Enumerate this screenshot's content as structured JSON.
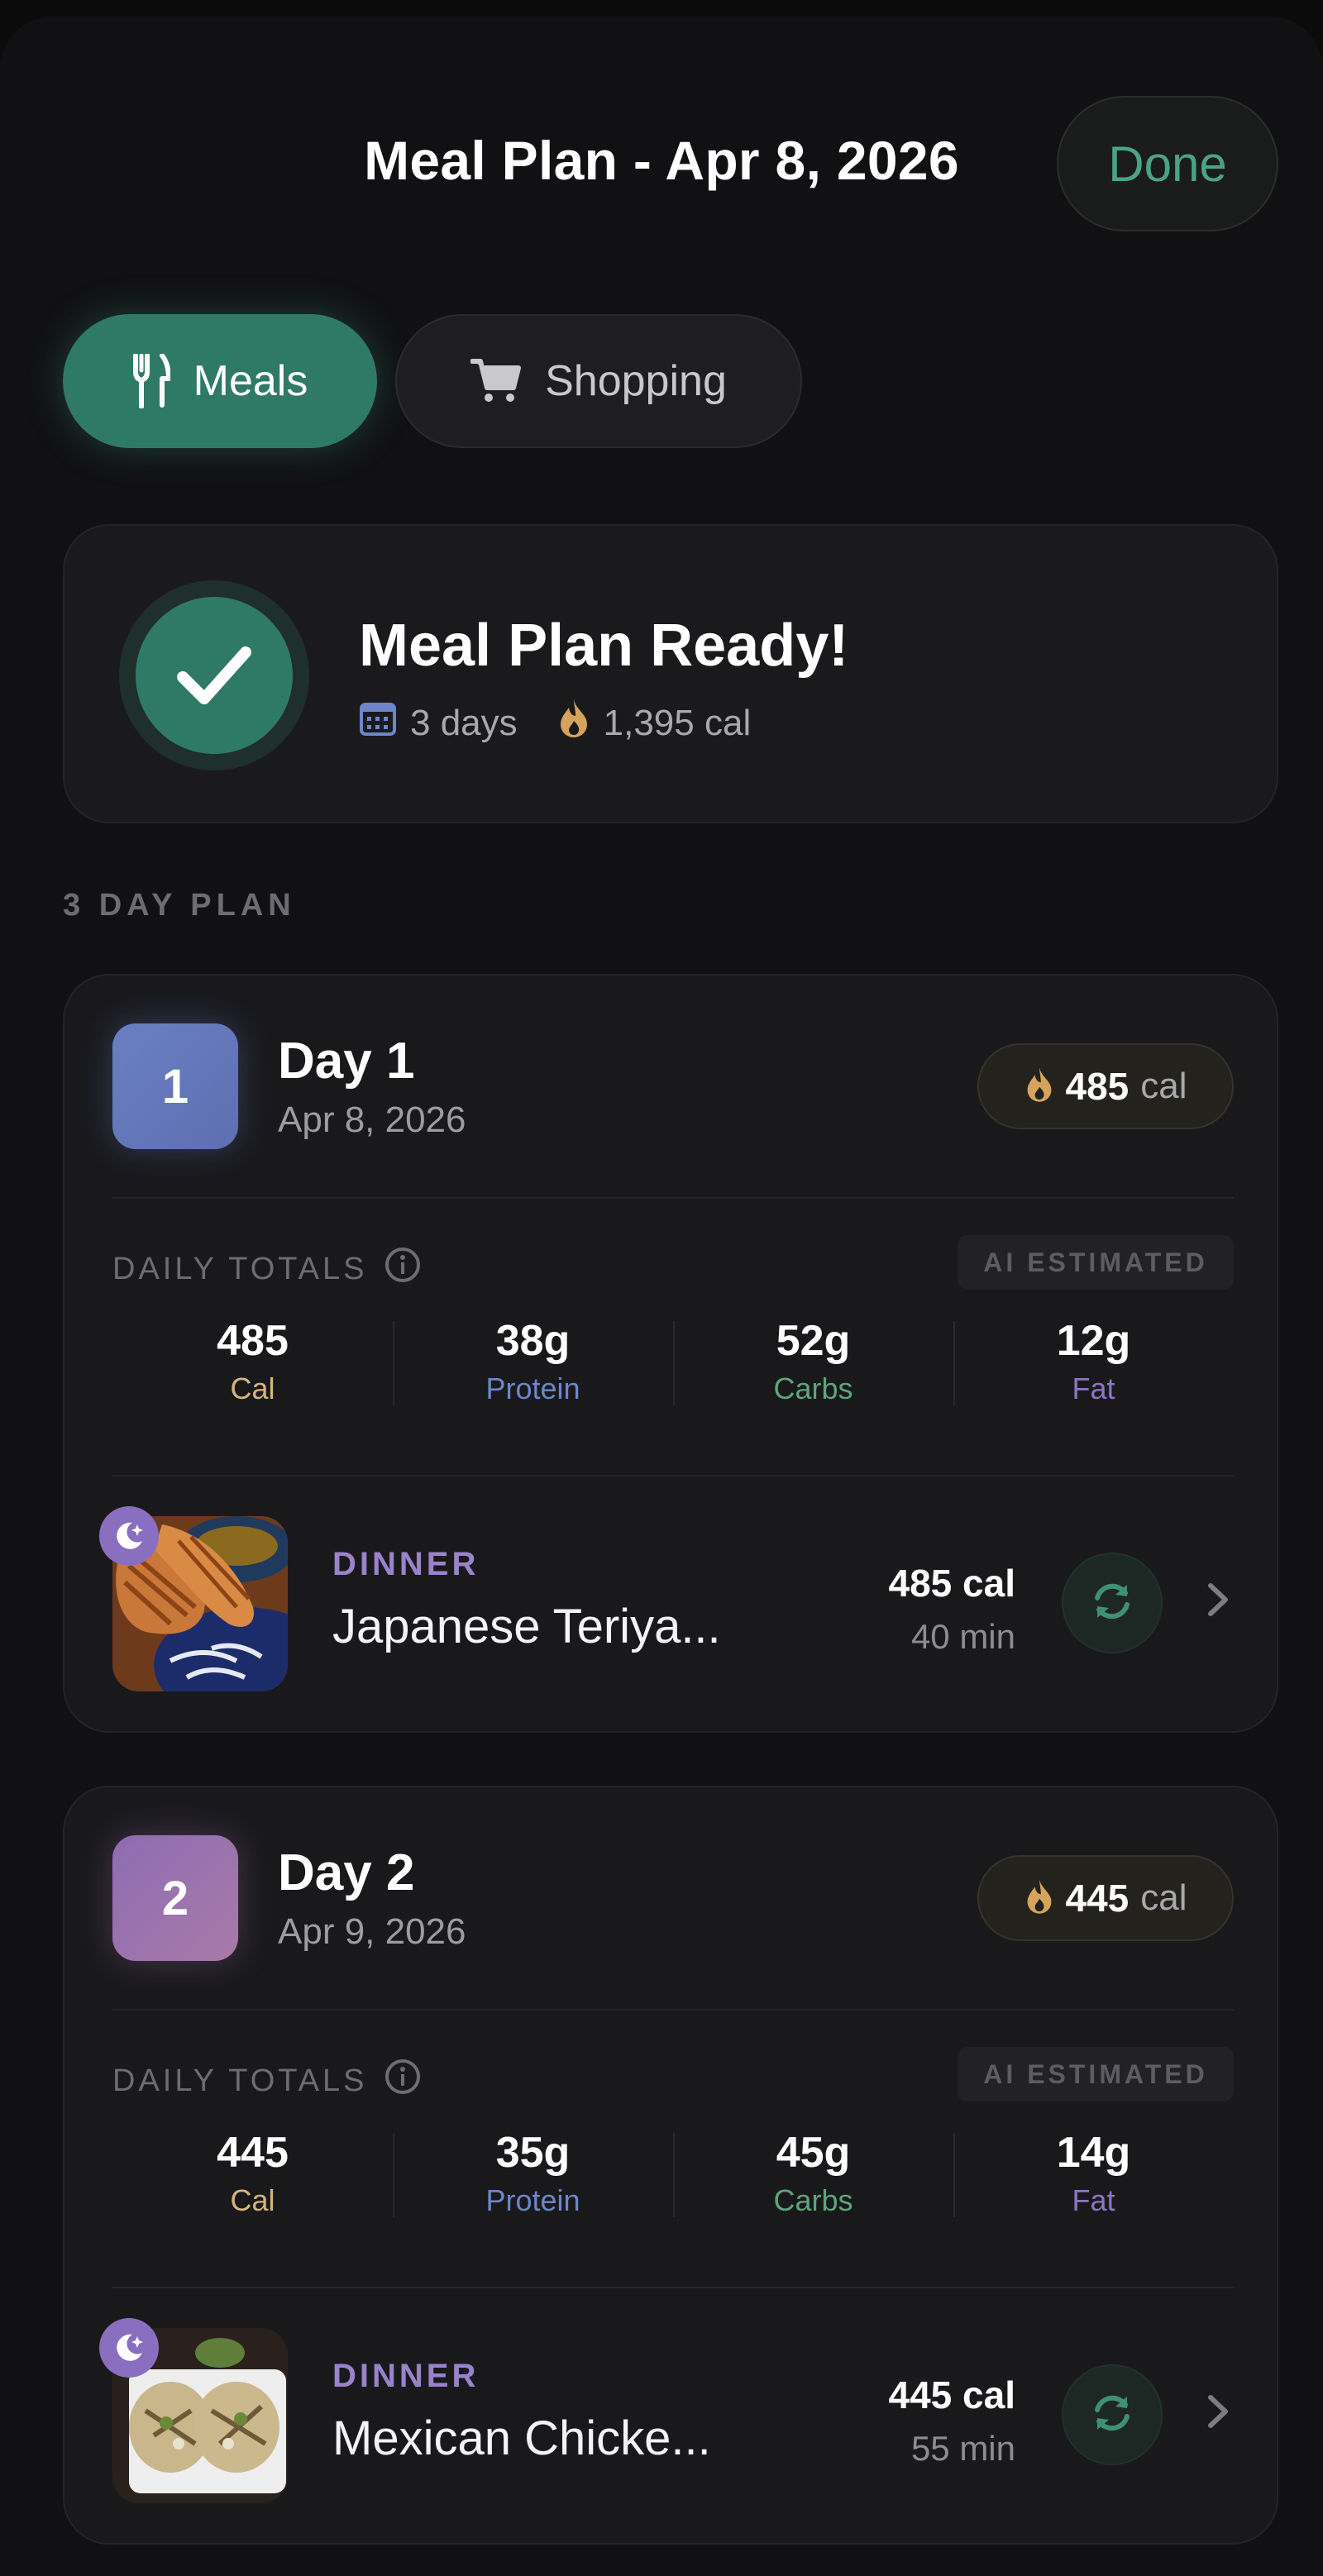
{
  "header": {
    "title": "Meal Plan - Apr 8, 2026",
    "done_label": "Done"
  },
  "tabs": [
    {
      "label": "Meals",
      "icon": "fork-knife-icon",
      "active": true
    },
    {
      "label": "Shopping",
      "icon": "cart-icon",
      "active": false
    }
  ],
  "ready": {
    "title": "Meal Plan Ready!",
    "days": "3 days",
    "calories": "1,395 cal"
  },
  "section_label": "3 DAY PLAN",
  "days": [
    {
      "badge": "1",
      "title": "Day 1",
      "date": "Apr 8, 2026",
      "cal_num": "485",
      "cal_unit": "cal",
      "totals_label": "DAILY TOTALS",
      "ai_label": "AI ESTIMATED",
      "macros": [
        {
          "value": "485",
          "label": "Cal"
        },
        {
          "value": "38g",
          "label": "Protein"
        },
        {
          "value": "52g",
          "label": "Carbs"
        },
        {
          "value": "12g",
          "label": "Fat"
        }
      ],
      "meal": {
        "type": "DINNER",
        "name": "Japanese Teriya...",
        "cal": "485 cal",
        "time": "40 min"
      }
    },
    {
      "badge": "2",
      "title": "Day 2",
      "date": "Apr 9, 2026",
      "cal_num": "445",
      "cal_unit": "cal",
      "totals_label": "DAILY TOTALS",
      "ai_label": "AI ESTIMATED",
      "macros": [
        {
          "value": "445",
          "label": "Cal"
        },
        {
          "value": "35g",
          "label": "Protein"
        },
        {
          "value": "45g",
          "label": "Carbs"
        },
        {
          "value": "14g",
          "label": "Fat"
        }
      ],
      "meal": {
        "type": "DINNER",
        "name": "Mexican Chicke...",
        "cal": "445 cal",
        "time": "55 min"
      }
    }
  ],
  "colors": {
    "accent": "#2f7a66",
    "done_text": "#4aa385",
    "cal": "#d6b47a",
    "protein": "#6d86c9",
    "carbs": "#5fa47a",
    "fat": "#8e74c4",
    "dinner": "#9a82cc"
  }
}
